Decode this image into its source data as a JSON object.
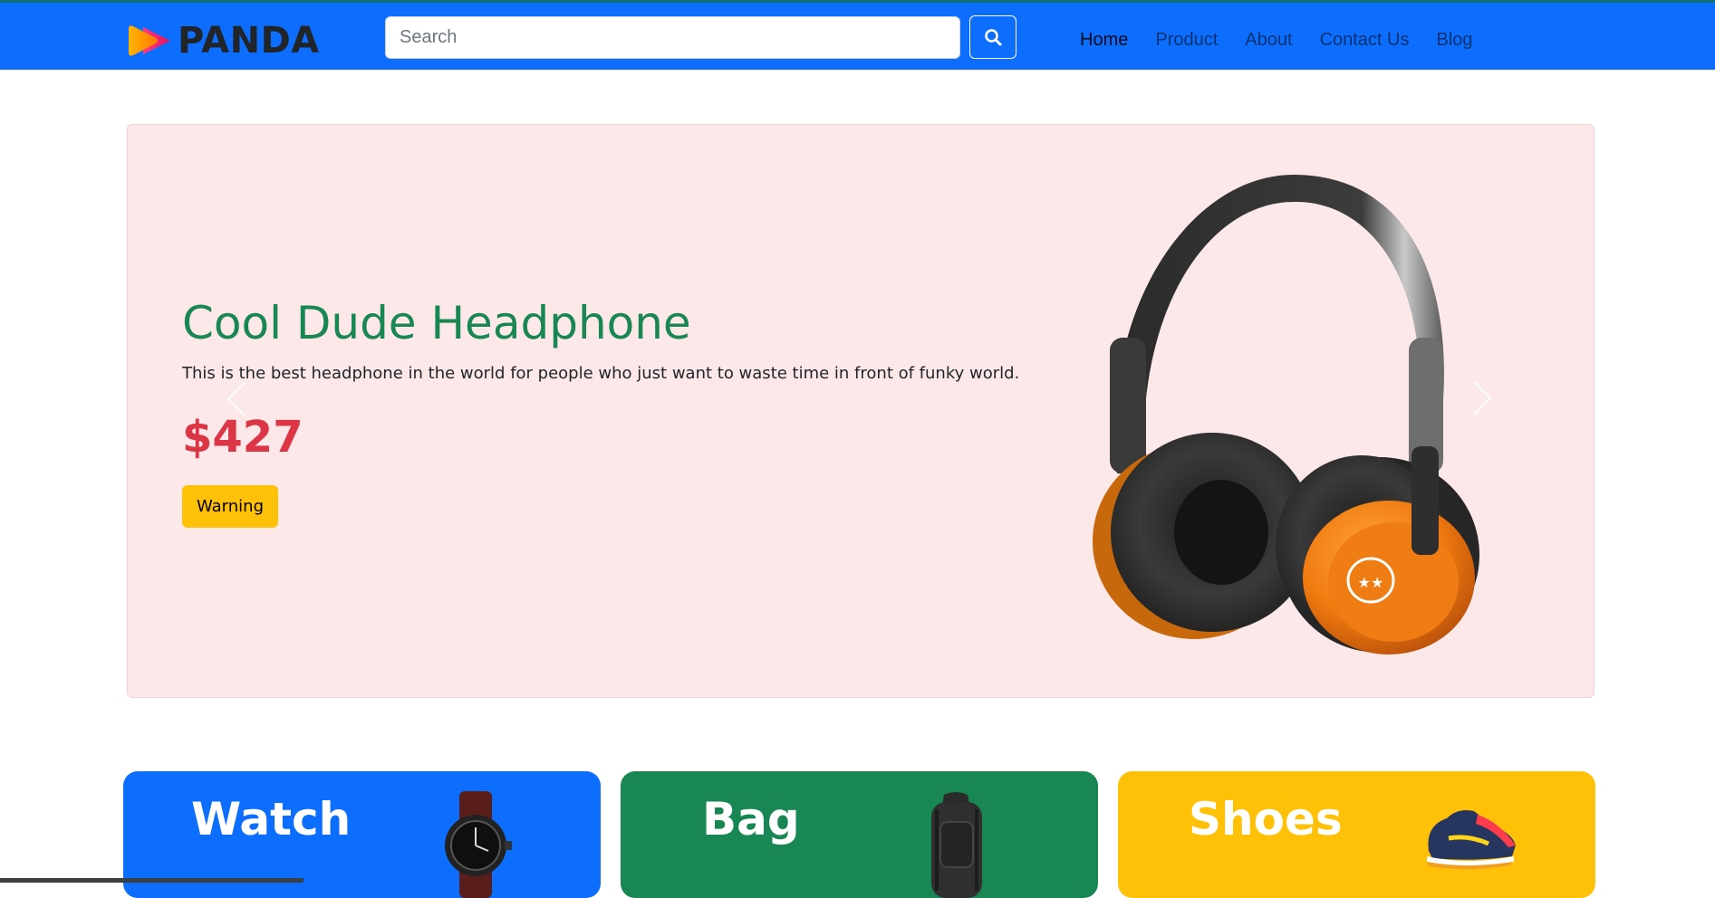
{
  "brand": {
    "name": "PANDA",
    "logo_icon": "play-arrow-logo-icon"
  },
  "search": {
    "placeholder": "Search",
    "value": "",
    "button_icon": "search-icon"
  },
  "nav": {
    "items": [
      {
        "label": "Home",
        "active": true
      },
      {
        "label": "Product",
        "active": false
      },
      {
        "label": "About",
        "active": false
      },
      {
        "label": "Contact Us",
        "active": false
      },
      {
        "label": "Blog",
        "active": false
      }
    ]
  },
  "hero": {
    "title": "Cool Dude Headphone",
    "description": "This is the best headphone in the world for people who just want to waste time in front of funky world.",
    "price": "$427",
    "button_label": "Warning",
    "image": "headphone-image",
    "prev_icon": "chevron-left-icon",
    "next_icon": "chevron-right-icon"
  },
  "categories": [
    {
      "title": "Watch",
      "image": "watch-image",
      "color": "#0d6efd"
    },
    {
      "title": "Bag",
      "image": "backpack-image",
      "color": "#198754"
    },
    {
      "title": "Shoes",
      "image": "sneaker-image",
      "color": "#ffc107"
    }
  ],
  "colors": {
    "navbar": "#0d6efd",
    "hero_background": "#fce8e8",
    "title_green": "#198754",
    "price_red": "#dc3545",
    "warning_yellow": "#ffc107"
  }
}
